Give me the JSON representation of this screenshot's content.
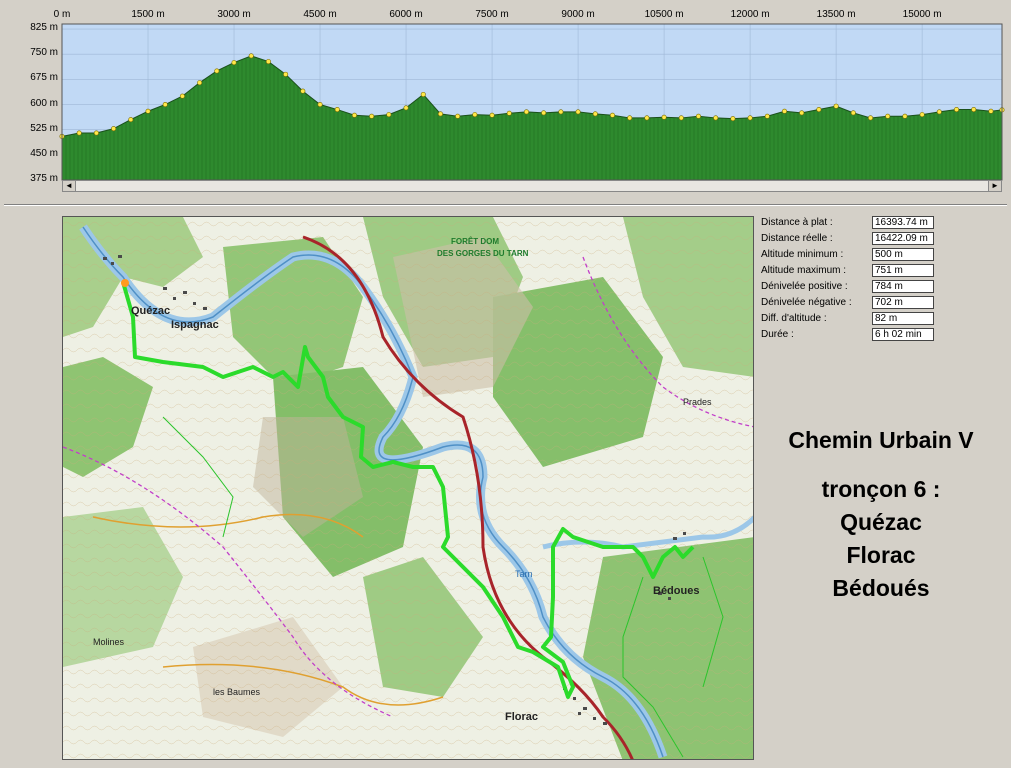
{
  "chart_data": {
    "type": "area",
    "x_ticks": [
      "0 m",
      "1500 m",
      "3000 m",
      "4500 m",
      "6000 m",
      "7500 m",
      "9000 m",
      "10500 m",
      "12000 m",
      "13500 m",
      "15000 m"
    ],
    "y_ticks": [
      "825 m",
      "750 m",
      "675 m",
      "600 m",
      "525 m",
      "450 m",
      "375 m"
    ],
    "xlim": [
      0,
      16393
    ],
    "ylim": [
      375,
      840
    ],
    "series": [
      {
        "x": [
          0,
          300,
          600,
          900,
          1200,
          1500,
          1800,
          2100,
          2400,
          2700,
          3000,
          3300,
          3600,
          3900,
          4200,
          4500,
          4800,
          5100,
          5400,
          5700,
          6000,
          6300,
          6600,
          6900,
          7200,
          7500,
          7800,
          8100,
          8400,
          8700,
          9000,
          9300,
          9600,
          9900,
          10200,
          10500,
          10800,
          11100,
          11400,
          11700,
          12000,
          12300,
          12600,
          12900,
          13200,
          13500,
          13800,
          14100,
          14400,
          14700,
          15000,
          15300,
          15600,
          15900,
          16200,
          16393
        ],
        "values": [
          505,
          515,
          515,
          528,
          555,
          580,
          600,
          625,
          665,
          700,
          725,
          745,
          728,
          690,
          640,
          600,
          585,
          568,
          565,
          570,
          590,
          630,
          572,
          565,
          570,
          568,
          574,
          578,
          575,
          578,
          578,
          572,
          568,
          560,
          560,
          562,
          560,
          565,
          560,
          558,
          560,
          565,
          580,
          575,
          585,
          595,
          575,
          560,
          565,
          565,
          570,
          578,
          585,
          585,
          580,
          584
        ]
      }
    ]
  },
  "stats": [
    {
      "label": "Distance à plat :",
      "value": "16393.74 m"
    },
    {
      "label": "Distance réelle :",
      "value": "16422.09 m"
    },
    {
      "label": "Altitude minimum :",
      "value": "500 m"
    },
    {
      "label": "Altitude maximum :",
      "value": "751 m"
    },
    {
      "label": "Dénivelée positive :",
      "value": "784 m"
    },
    {
      "label": "Dénivelée négative :",
      "value": "702 m"
    },
    {
      "label": "Diff. d'altitude :",
      "value": "82 m"
    },
    {
      "label": "Durée :",
      "value": "6 h 02 min"
    }
  ],
  "title": {
    "line1": "Chemin Urbain V",
    "line2": "tronçon 6 :",
    "line3": "Quézac",
    "line4": "Florac",
    "line5": "Bédoués"
  },
  "map": {
    "labels": {
      "quezac": "Quézac",
      "ispagnac": "Ispagnac",
      "florac": "Florac",
      "bedoues": "Bédoues",
      "foret": "FORÊT DOM",
      "gorges": "DES GORGES DU TARN",
      "tarn": "Tarn",
      "baumes": "les Baumes",
      "molines": "Molines",
      "prades": "Prades"
    }
  },
  "scroll": {
    "left_arrow": "◄",
    "right_arrow": "►"
  }
}
